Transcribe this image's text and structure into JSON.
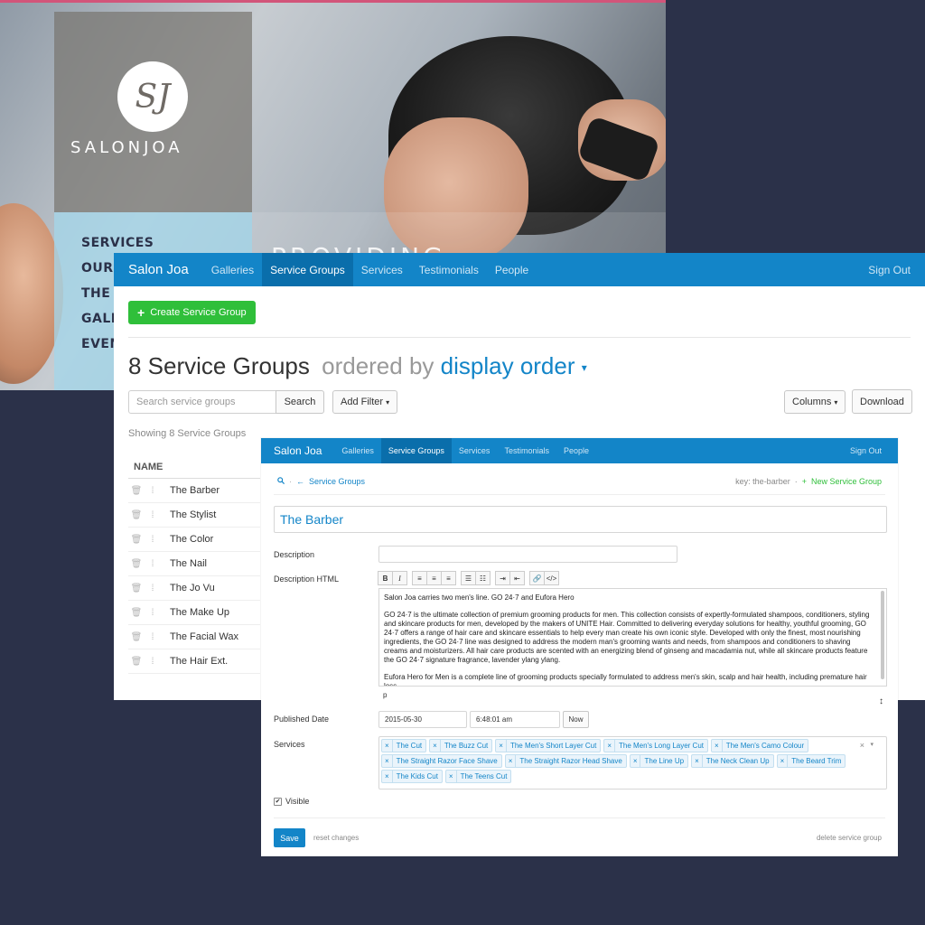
{
  "site": {
    "logo_mark": "SJ",
    "logo_text": "SALONJOA",
    "nav_items": [
      "SERVICES",
      "OUR T",
      "THE S",
      "GALL",
      "EVEN"
    ],
    "tagline": "PROVIDING"
  },
  "list_window": {
    "brand": "Salon Joa",
    "nav": [
      "Galleries",
      "Service Groups",
      "Services",
      "Testimonials",
      "People"
    ],
    "active_nav": "Service Groups",
    "sign_out": "Sign Out",
    "create_button": "Create Service Group",
    "title_count": "8 Service Groups",
    "title_ordered": "ordered by",
    "title_order": "display order",
    "search_placeholder": "Search service groups",
    "search_button": "Search",
    "add_filter_button": "Add Filter",
    "columns_button": "Columns",
    "download_button": "Download",
    "showing_text": "Showing 8 Service Groups",
    "column_name": "NAME",
    "rows": [
      "The Barber",
      "The Stylist",
      "The Color",
      "The Nail",
      "The Jo Vu",
      "The Make Up",
      "The Facial Wax",
      "The Hair Ext."
    ]
  },
  "edit_window": {
    "brand": "Salon Joa",
    "nav": [
      "Galleries",
      "Service Groups",
      "Services",
      "Testimonials",
      "People"
    ],
    "active_nav": "Service Groups",
    "sign_out": "Sign Out",
    "breadcrumb_search": "search-icon",
    "breadcrumb_back": "Service Groups",
    "key_text": "key: the-barber",
    "new_group_link": "New Service Group",
    "name_value": "The Barber",
    "description_label": "Description",
    "description_html_label": "Description HTML",
    "editor_paragraphs": [
      "Salon Joa carries two men's line.  GO 24·7  and Eufora Hero",
      "GO 24·7 is the ultimate collection of premium grooming products for men.  This collection consists of expertly-formulated shampoos, conditioners, styling and skincare products for men, developed by the makers of UNITE Hair. Committed to delivering everyday solutions for healthy, youthful grooming, GO 24·7 offers a range of hair care and skincare essentials to help every man create his own iconic style. Developed with only the finest, most nourishing ingredients, the GO 24·7 line was designed to address the modern man's grooming wants and needs, from shampoos and conditioners to shaving creams and moisturizers. All hair care products are scented with an energizing blend of ginseng and macadamia nut, while all skincare products feature the GO 24·7 signature fragrance, lavender ylang ylang.",
      "Eufora Hero  for Men is a complete line of grooming products specially formulated to address men's skin, scalp and hair health, including premature hair loss."
    ],
    "editor_status": "p",
    "published_label": "Published Date",
    "published_date": "2015-05-30",
    "published_time": "6:48:01 am",
    "now_button": "Now",
    "services_label": "Services",
    "services": [
      "The Cut",
      "The Buzz Cut",
      "The Men's Short Layer Cut",
      "The Men's Long Layer Cut",
      "The Men's Camo Colour",
      "The Straight Razor Face Shave",
      "The Straight Razor Head Shave",
      "The Line Up",
      "The Neck Clean Up",
      "The Beard Trim",
      "The Kids Cut",
      "The Teens Cut"
    ],
    "visible_label": "Visible",
    "visible_checked": "✔",
    "save_button": "Save",
    "reset_link": "reset changes",
    "delete_link": "delete service group"
  },
  "colors": {
    "navbar": "#1385c8",
    "navbar_active": "#0a6eab",
    "create_button": "#2fbf3a",
    "background": "#2b3149"
  }
}
